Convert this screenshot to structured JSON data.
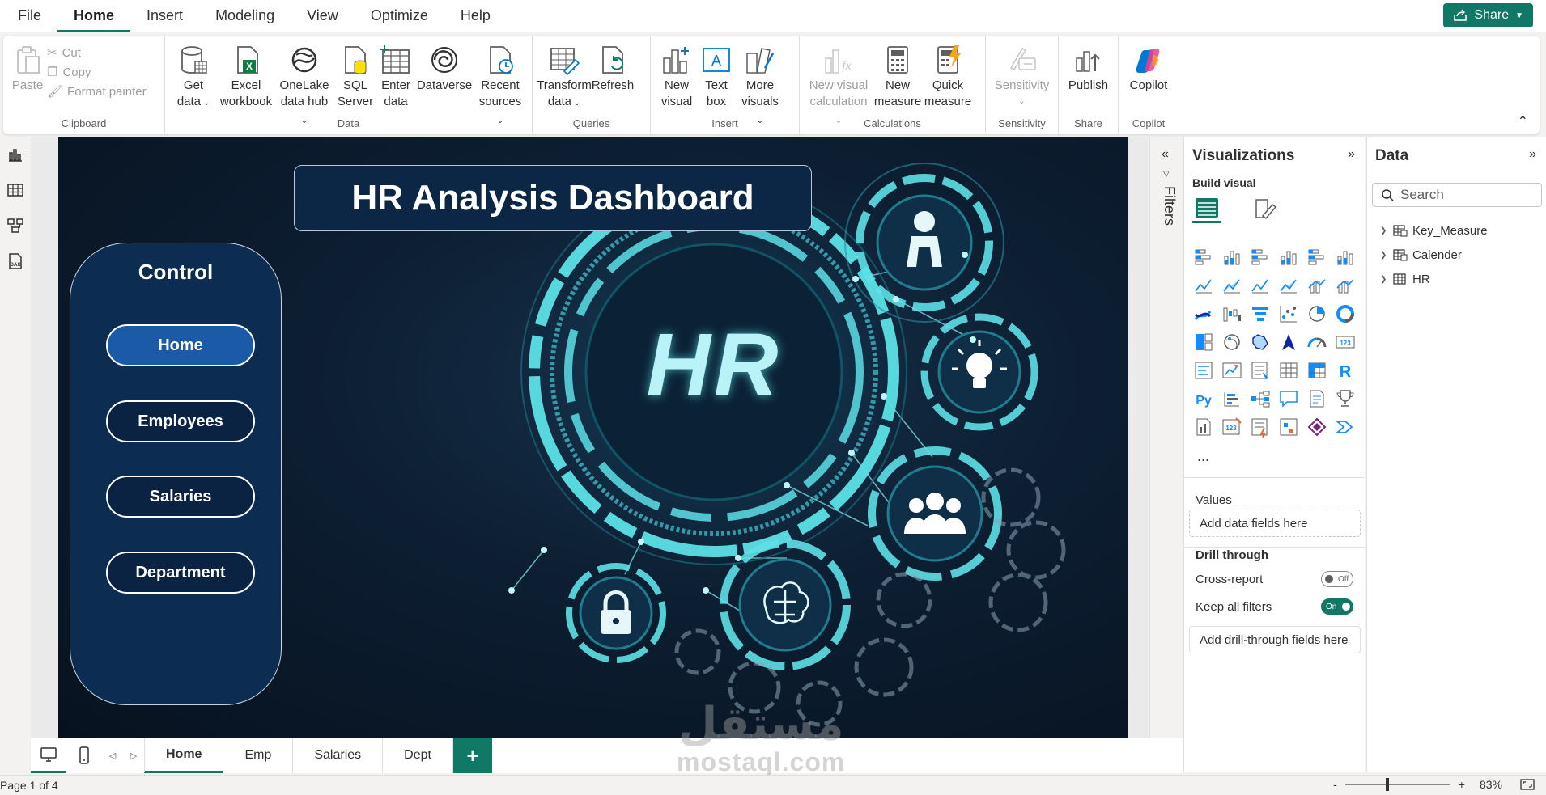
{
  "menu": {
    "items": [
      "File",
      "Home",
      "Insert",
      "Modeling",
      "View",
      "Optimize",
      "Help"
    ],
    "active": "Home",
    "share": "Share"
  },
  "ribbon": {
    "clipboard": {
      "paste": "Paste",
      "cut": "Cut",
      "copy": "Copy",
      "format_painter": "Format painter",
      "label": "Clipboard"
    },
    "data": {
      "label": "Data",
      "buttons": [
        {
          "l1": "Get",
          "l2": "data",
          "dropdown": true,
          "icon": "database-icon"
        },
        {
          "l1": "Excel",
          "l2": "workbook",
          "dropdown": false,
          "icon": "excel-icon"
        },
        {
          "l1": "OneLake",
          "l2": "data hub",
          "dropdown": true,
          "icon": "onelake-icon"
        },
        {
          "l1": "SQL",
          "l2": "Server",
          "dropdown": false,
          "icon": "sql-server-icon"
        },
        {
          "l1": "Enter",
          "l2": "data",
          "dropdown": false,
          "icon": "table-icon"
        },
        {
          "l1": "Dataverse",
          "l2": "",
          "dropdown": false,
          "icon": "dataverse-icon"
        },
        {
          "l1": "Recent",
          "l2": "sources",
          "dropdown": true,
          "icon": "recent-icon"
        }
      ]
    },
    "queries": {
      "label": "Queries",
      "transform_l1": "Transform",
      "transform_l2": "data",
      "refresh": "Refresh"
    },
    "insert": {
      "label": "Insert",
      "new_visual_l1": "New",
      "new_visual_l2": "visual",
      "text_box_l1": "Text",
      "text_box_l2": "box",
      "more_visuals_l1": "More",
      "more_visuals_l2": "visuals"
    },
    "calculations": {
      "label": "Calculations",
      "new_visual_calc_l1": "New visual",
      "new_visual_calc_l2": "calculation",
      "new_measure_l1": "New",
      "new_measure_l2": "measure",
      "quick_measure_l1": "Quick",
      "quick_measure_l2": "measure"
    },
    "sensitivity": {
      "label": "Sensitivity",
      "button": "Sensitivity"
    },
    "share": {
      "label": "Share",
      "publish": "Publish"
    },
    "copilot": {
      "label": "Copilot",
      "button": "Copilot"
    }
  },
  "report": {
    "title": "HR Analysis Dashboard",
    "control": {
      "title": "Control",
      "buttons": [
        "Home",
        "Employees",
        "Salaries",
        "Department"
      ],
      "active": "Home"
    },
    "hero_text": "HR"
  },
  "filters": {
    "label": "Filters"
  },
  "visualizations": {
    "title": "Visualizations",
    "build_visual": "Build visual",
    "more": "...",
    "values_label": "Values",
    "values_placeholder": "Add data fields here",
    "drill_through": "Drill through",
    "cross_report": "Cross-report",
    "cross_report_state": "Off",
    "keep_all_filters": "Keep all filters",
    "keep_all_filters_state": "On",
    "drill_placeholder": "Add drill-through fields here"
  },
  "data_pane": {
    "title": "Data",
    "search_placeholder": "Search",
    "tables": [
      {
        "name": "Key_Measure",
        "icon": "measure-table-icon"
      },
      {
        "name": "Calender",
        "icon": "calendar-table-icon"
      },
      {
        "name": "HR",
        "icon": "table-icon"
      }
    ]
  },
  "pages": {
    "tabs": [
      "Home",
      "Emp",
      "Salaries",
      "Dept"
    ],
    "active": "Home",
    "add": "+"
  },
  "status": {
    "page": "Page 1 of 4",
    "zoom_minus": "-",
    "zoom_plus": "+",
    "zoom": "83%"
  },
  "watermark": {
    "arabic": "مستقل",
    "latin": "mostaql.com"
  },
  "colors": {
    "accent": "#117865",
    "report_bg": "#0d1f33",
    "control_bg": "#0c2c52",
    "nav_active": "#1b5aa6",
    "hr_cyan": "#5ce1e6"
  }
}
